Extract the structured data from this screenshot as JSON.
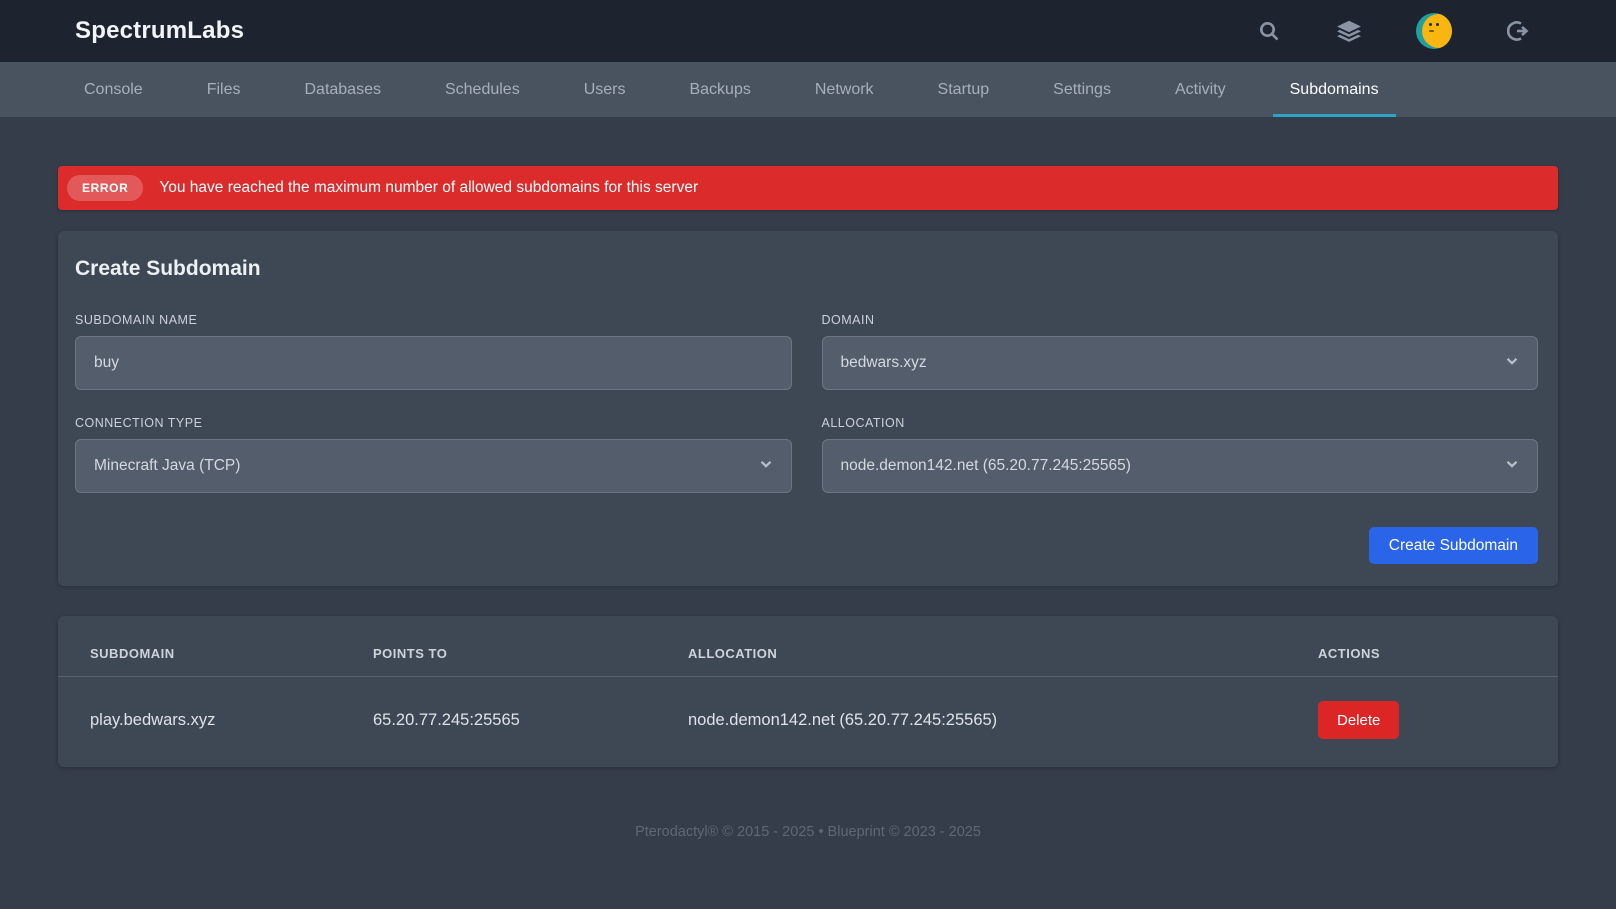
{
  "app": {
    "title": "SpectrumLabs"
  },
  "header": {
    "icons": [
      "search-icon",
      "layers-icon",
      "user-avatar",
      "logout-icon"
    ]
  },
  "nav": {
    "tabs": [
      {
        "label": "Console",
        "active": false
      },
      {
        "label": "Files",
        "active": false
      },
      {
        "label": "Databases",
        "active": false
      },
      {
        "label": "Schedules",
        "active": false
      },
      {
        "label": "Users",
        "active": false
      },
      {
        "label": "Backups",
        "active": false
      },
      {
        "label": "Network",
        "active": false
      },
      {
        "label": "Startup",
        "active": false
      },
      {
        "label": "Settings",
        "active": false
      },
      {
        "label": "Activity",
        "active": false
      },
      {
        "label": "Subdomains",
        "active": true
      }
    ]
  },
  "alert": {
    "badge": "ERROR",
    "message": "You have reached the maximum number of allowed subdomains for this server"
  },
  "form": {
    "title": "Create Subdomain",
    "fields": {
      "subdomain_name": {
        "label": "SUBDOMAIN NAME",
        "value": "buy"
      },
      "domain": {
        "label": "DOMAIN",
        "value": "bedwars.xyz"
      },
      "connection_type": {
        "label": "CONNECTION TYPE",
        "value": "Minecraft Java (TCP)"
      },
      "allocation": {
        "label": "ALLOCATION",
        "value": "node.demon142.net (65.20.77.245:25565)"
      }
    },
    "submit_label": "Create Subdomain"
  },
  "table": {
    "columns": [
      "SUBDOMAIN",
      "POINTS TO",
      "ALLOCATION",
      "ACTIONS"
    ],
    "rows": [
      {
        "subdomain": "play.bedwars.xyz",
        "points_to": "65.20.77.245:25565",
        "allocation": "node.demon142.net (65.20.77.245:25565)",
        "action_label": "Delete"
      }
    ]
  },
  "footer": {
    "text": "Pterodactyl® © 2015 - 2025  •  Blueprint © 2023 - 2025"
  },
  "colors": {
    "accent": "#2ea3c4",
    "error_red": "#dc2b2b",
    "primary_blue": "#2a64e8",
    "delete_red": "#dc2626",
    "avatar_yellow": "#f9b510",
    "avatar_teal": "#1f9f9f",
    "header_bg": "#1d2430",
    "nav_bg": "#49525f",
    "page_bg": "#353d4a",
    "card_bg": "#3e4855"
  }
}
